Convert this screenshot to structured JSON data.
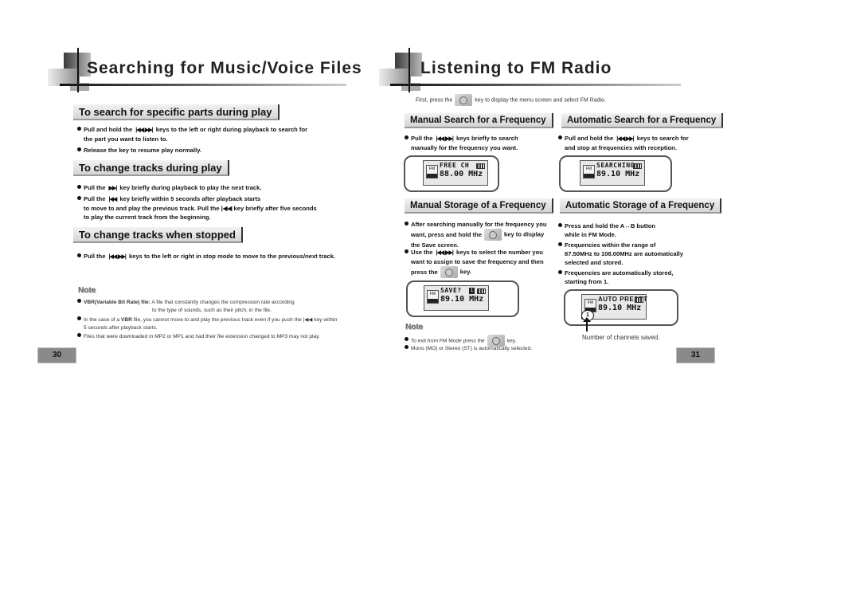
{
  "left_page": {
    "title": "Searching for Music/Voice Files",
    "sections": [
      {
        "heading": "To search for specific parts during play",
        "bullets": [
          {
            "pre": "Pull and hold the ",
            "key": "|◀◀, ▶▶|",
            "post": " keys to the left or right during playback to search for",
            "cont": "the part you want to listen to."
          },
          {
            "pre": "Release the key to resume play normally.",
            "key": "",
            "post": "",
            "cont": ""
          }
        ]
      },
      {
        "heading": "To change tracks during play",
        "bullets": [
          {
            "pre": "Pull the ",
            "key": "▶▶|",
            "post": " key briefly during playback to play the next track.",
            "cont": ""
          },
          {
            "pre": "Pull the ",
            "key": "|◀◀",
            "post": " key briefly within 5 seconds after playback starts",
            "cont": "to move to and play the previous track. Pull the |◀◀ key briefly after five seconds",
            "cont2": "to play the current track from the beginning."
          }
        ]
      },
      {
        "heading": "To change tracks when stopped",
        "bullets": [
          {
            "pre": "Pull the ",
            "key": "|◀◀, ▶▶|",
            "post": " keys to the left or right in stop mode to move to the previous/next track.",
            "cont": ""
          }
        ]
      }
    ],
    "note": {
      "heading": "Note",
      "items": [
        {
          "bold": "VBR(Variable Bit Rate) file:",
          "text": " A file that constantly changes the compression rate according",
          "cont": "to the type of sounds, such as their pitch, in the file."
        },
        {
          "text1": "In the case of a ",
          "bold": "VBR",
          "text": " file, you cannot move to and play the previous track even if you push the |◀◀ key within",
          "cont": "5 seconds after playback starts."
        },
        {
          "text": "Files that were downloaded in MP2 or MP1 and had their file extension changed to MP3 may not play."
        }
      ]
    },
    "page_number": "30"
  },
  "right_page": {
    "title": "Listening to FM Radio",
    "intro_pre": "First, press the",
    "intro_post": "key to display the menu screen and select FM Radio.",
    "manual_search": {
      "heading": "Manual Search for a Frequency",
      "line1_pre": "Pull the ",
      "line1_key": "|◀◀, ▶▶|",
      "line1_post": " keys briefly to search",
      "line2": "manually for the frequency you want.",
      "lcd": {
        "line1": "FREE  CH",
        "line2": "88.00 MHz"
      }
    },
    "auto_search": {
      "heading": "Automatic Search for a Frequency",
      "line1_pre": "Pull and hold the ",
      "line1_key": "|◀◀, ▶▶|",
      "line1_post": " keys to search for",
      "line2": "and stop at frequencies with reception.",
      "lcd": {
        "line1": "SEARCHING",
        "line2": "89.10 MHz"
      }
    },
    "manual_storage": {
      "heading": "Manual Storage of a Frequency",
      "b1_l1": "After searching manually for the frequency you",
      "b1_l2_pre": "want, press and hold the",
      "b1_l2_post": "key to display",
      "b1_l3": "the Save screen.",
      "b2_l1_pre": "Use the ",
      "b2_l1_key": "|◀◀, ▶▶|",
      "b2_l1_post": " keys to select the number you",
      "b2_l2": "want to assign to save the frequency and then",
      "b2_l3_pre": "press the",
      "b2_l3_post": "key.",
      "lcd": {
        "line1": "SAVE?",
        "num": "1",
        "line2": "89.10 MHz"
      }
    },
    "auto_storage": {
      "heading": "Automatic Storage of a Frequency",
      "b1_l1": "Press and hold the A↔B button",
      "b1_l2": "while in FM Mode.",
      "b2_l1": "Frequencies within the range of",
      "b2_l2": "87.50MHz to 108.00MHz are automatically",
      "b2_l3": "selected and stored.",
      "b3_l1": "Frequencies are automatically stored,",
      "b3_l2": "starting from 1.",
      "lcd": {
        "line1": "AUTO PRESET",
        "line2": "89.10 MHz",
        "channel": "1"
      },
      "caption": "Number of channels saved."
    },
    "note": {
      "heading": "Note",
      "item1_pre": "To exit from FM Mode press the",
      "item1_post": "key.",
      "item2": "Mono (MO) or Stereo (ST) is automatically selected."
    },
    "page_number": "31"
  }
}
